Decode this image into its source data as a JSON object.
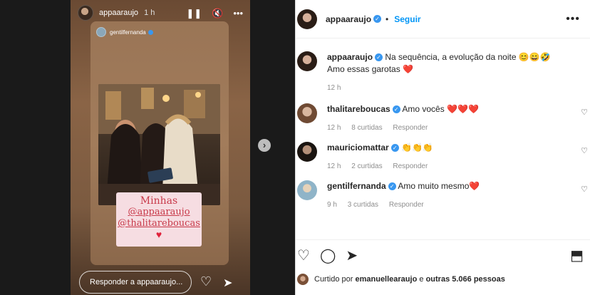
{
  "story": {
    "username": "appaaraujo",
    "time": "1 h",
    "controls": {
      "pause": "❚❚",
      "mute": "🔇",
      "more": "•••"
    },
    "repost": {
      "username": "gentilfernanda"
    },
    "sticker": {
      "line1": "Minhas",
      "line2": "@appaaraujo",
      "line3": "@thalitareboucas",
      "heart": "♥"
    },
    "reply_placeholder": "Responder a appaaraujo...",
    "next": "›"
  },
  "post": {
    "header": {
      "username": "appaaraujo",
      "follow": "Seguir",
      "more": "•••"
    },
    "caption": {
      "username": "appaaraujo",
      "text": "Na sequência, a evolução da noite 😊😄🤣 Amo essas garotas ❤️",
      "time": "12 h"
    },
    "comments": [
      {
        "username": "thalitareboucas",
        "text": "Amo vocês ❤️❤️❤️",
        "time": "12 h",
        "likes": "8 curtidas",
        "reply": "Responder"
      },
      {
        "username": "mauriciomattar",
        "text": "👏👏👏",
        "time": "12 h",
        "likes": "2 curtidas",
        "reply": "Responder"
      },
      {
        "username": "gentilfernanda",
        "text": "Amo muito mesmo❤️",
        "time": "9 h",
        "likes": "3 curtidas",
        "reply": "Responder"
      }
    ],
    "actions": {
      "like": "♡",
      "comment": "◯",
      "share": "➤",
      "save": "⬒"
    },
    "liked_by": {
      "prefix": "Curtido por",
      "user": "emanuellearaujo",
      "middle": "e",
      "others": "outras 5.066 pessoas"
    }
  }
}
